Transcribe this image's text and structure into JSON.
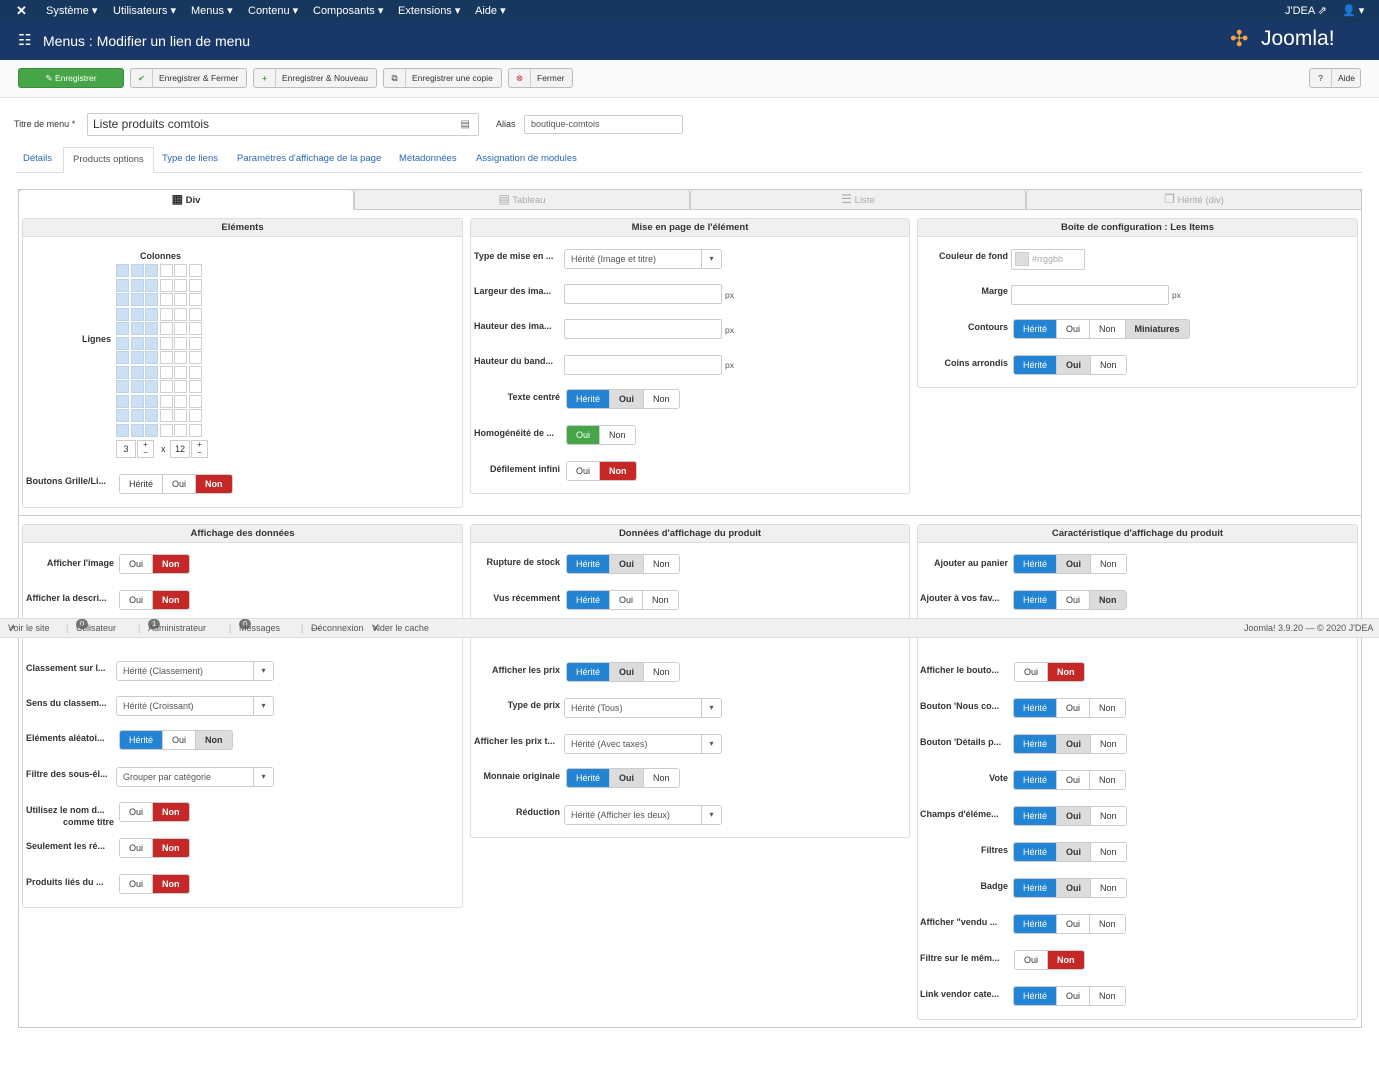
{
  "topnav": {
    "items": [
      "Système",
      "Utilisateurs",
      "Menus",
      "Contenu",
      "Composants",
      "Extensions",
      "Aide"
    ],
    "site": "J'DEA"
  },
  "header": {
    "title": "Menus : Modifier un lien de menu",
    "brand": "Joomla!"
  },
  "toolbar": {
    "save": "Enregistrer",
    "save_close": "Enregistrer & Fermer",
    "save_new": "Enregistrer & Nouveau",
    "save_copy": "Enregistrer une copie",
    "close": "Fermer",
    "help": "Aide"
  },
  "form": {
    "title_label": "Titre de menu *",
    "title_value": "Liste produits comtois",
    "alias_label": "Alias",
    "alias_value": "boutique-comtois"
  },
  "tabs": [
    "Détails",
    "Products options",
    "Type de liens",
    "Paramètres d'affichage de la page",
    "Métadonnées",
    "Assignation de modules"
  ],
  "view_tabs": [
    "Div",
    "Tableau",
    "Liste",
    "Hérité (div)"
  ],
  "panels": {
    "elements": {
      "title": "Eléments",
      "colonnes": "Colonnes",
      "lignes": "Lignes",
      "cols_value": "3",
      "x": "x",
      "rows_value": "12",
      "buttons_label": "Boutons Grille/Li...",
      "buttons": [
        "Hérité",
        "Oui",
        "Non"
      ]
    },
    "layout": {
      "title": "Mise en page de l'élément",
      "type_label": "Type de mise en ...",
      "type_value": "Hérité (Image et titre)",
      "width_label": "Largeur des ima...",
      "height_label": "Hauteur des ima...",
      "band_label": "Hauteur du band...",
      "px": "px",
      "centered_label": "Texte centré",
      "homog_label": "Homogénéité de ...",
      "infinite_label": "Défilement infini"
    },
    "config": {
      "title": "Boite de configuration : Les Items",
      "bg_label": "Couleur de fond",
      "bg_placeholder": "#rrggbb",
      "margin_label": "Marge",
      "px": "px",
      "border_label": "Contours",
      "border_opts": [
        "Hérité",
        "Oui",
        "Non",
        "Miniatures"
      ],
      "rounded_label": "Coins arrondis"
    },
    "display": {
      "title": "Affichage des données",
      "image_label": "Afficher l'image",
      "desc_label": "Afficher la descri...",
      "sort_label": "Classement sur l...",
      "sort_value": "Hérité (Classement)",
      "dir_label": "Sens du classem...",
      "dir_value": "Hérité (Croissant)",
      "random_label": "Eléments aléatoi...",
      "filter_label": "Filtre des sous-él...",
      "filter_value": "Grouper par catégorie",
      "usename_label": "Utilisez le nom d...",
      "usename_label2": "comme titre",
      "only_label": "Seulement les ré...",
      "related_label": "Produits liés du ..."
    },
    "product": {
      "title": "Données d'affichage du produit",
      "stock_label": "Rupture de stock",
      "recent_label": "Vus récemment",
      "prices_label": "Afficher les prix",
      "pricetype_label": "Type de prix",
      "pricetype_value": "Hérité (Tous)",
      "pricetax_label": "Afficher les prix t...",
      "pricetax_value": "Hérité (Avec taxes)",
      "currency_label": "Monnaie originale",
      "discount_label": "Réduction",
      "discount_value": "Hérité (Afficher les deux)"
    },
    "features": {
      "title": "Caractéristique d'affichage du produit",
      "cart_label": "Ajouter au panier",
      "fav_label": "Ajouter à vos fav...",
      "btn_label": "Afficher le bouto...",
      "contact_label": "Bouton 'Nous co...",
      "details_label": "Bouton 'Détails p...",
      "vote_label": "Vote",
      "fields_label": "Champs d'éléme...",
      "filters_label": "Filtres",
      "badge_label": "Badge",
      "sold_label": "Afficher \"vendu ...",
      "samefilter_label": "Filtre sur le mêm...",
      "vendor_label": "Link vendor cate..."
    }
  },
  "opts": {
    "h": "Hérité",
    "o": "Oui",
    "n": "Non"
  },
  "statusbar": {
    "site": "Voir le site",
    "users_count": "0",
    "users": "Utilisateur",
    "admin_count": "1",
    "admin": "Administrateur",
    "msg_count": "0",
    "messages": "Messages",
    "logout": "Déconnexion",
    "cache": "Vider le cache",
    "version": "Joomla! 3.9.20 — © 2020 J'DEA"
  },
  "colors": {
    "nav": "#17385e",
    "header": "#1a3867",
    "save": "#46a546",
    "active": "#2384d3",
    "no": "#c52827"
  }
}
